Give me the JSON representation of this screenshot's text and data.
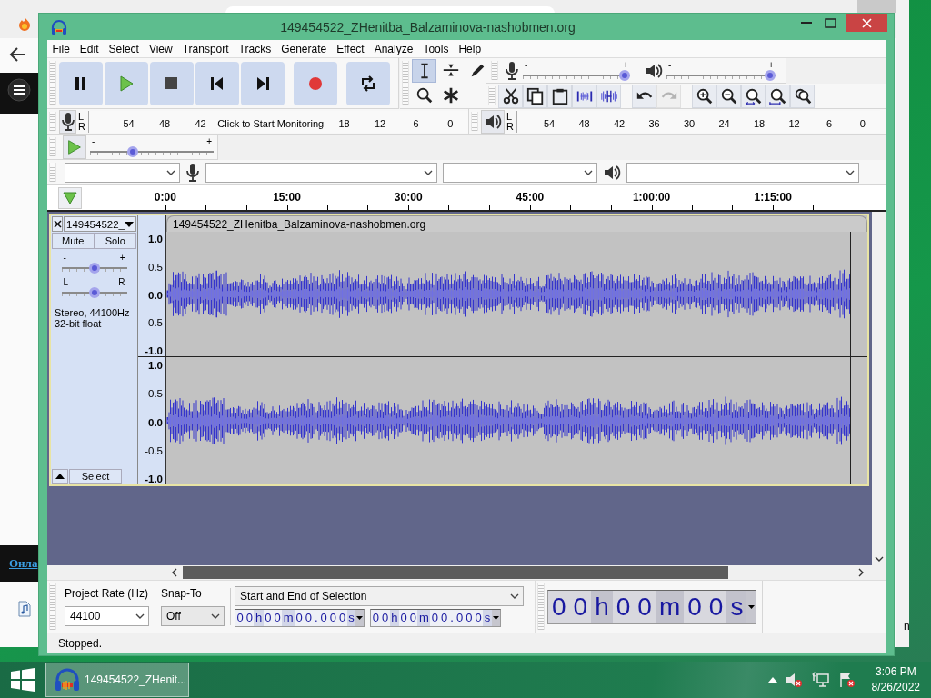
{
  "browser": {
    "link": "Онла",
    "edge_text": "n"
  },
  "window": {
    "title": "149454522_ZHenitba_Balzaminova-nashobmen.org"
  },
  "menu": [
    "File",
    "Edit",
    "Select",
    "View",
    "Transport",
    "Tracks",
    "Generate",
    "Effect",
    "Analyze",
    "Tools",
    "Help"
  ],
  "tools": [
    {
      "selected": true
    },
    {
      "selected": false
    },
    {
      "selected": false
    },
    {
      "selected": false
    },
    {
      "selected": false
    }
  ],
  "recording_volume": {
    "min_label": "-",
    "max_label": "+",
    "level": 1
  },
  "playback_volume": {
    "min_label": "-",
    "max_label": "+",
    "level": 1
  },
  "history": [
    {
      "disabled": false
    },
    {
      "disabled": true
    }
  ],
  "recording_meter": {
    "channels": [
      "L",
      "R"
    ],
    "scale": [
      {
        "kind": "tick",
        "label": "-54"
      },
      {
        "kind": "tick",
        "label": "-48"
      },
      {
        "kind": "tick",
        "label": "-42"
      },
      {
        "kind": "prompt",
        "label": "Click to Start Monitoring"
      },
      {
        "kind": "tick",
        "label": "-18"
      },
      {
        "kind": "tick",
        "label": "-12"
      },
      {
        "kind": "tick",
        "label": "-6"
      },
      {
        "kind": "tick",
        "label": "0"
      }
    ]
  },
  "playback_meter": {
    "channels": [
      "L",
      "R"
    ],
    "scale": [
      {
        "kind": "tick",
        "label": "-54"
      },
      {
        "kind": "tick",
        "label": "-48"
      },
      {
        "kind": "tick",
        "label": "-42"
      },
      {
        "kind": "tick",
        "label": "-36"
      },
      {
        "kind": "tick",
        "label": "-30"
      },
      {
        "kind": "tick",
        "label": "-24"
      },
      {
        "kind": "tick",
        "label": "-18"
      },
      {
        "kind": "tick",
        "label": "-12"
      },
      {
        "kind": "tick",
        "label": "-6"
      },
      {
        "kind": "tick",
        "label": "0"
      }
    ]
  },
  "play_at_speed": {
    "min_label": "-",
    "max_label": "+",
    "level": 0.33
  },
  "timeline": [
    "0:00",
    "15:00",
    "30:00",
    "45:00",
    "1:00:00",
    "1:15:00"
  ],
  "track": {
    "name": "149454522_",
    "clip_title": "149454522_ZHenitba_Balzaminova-nashobmen.org",
    "buttons": [
      "Mute",
      "Solo"
    ],
    "gain": {
      "min_label": "-",
      "max_label": "+",
      "level": 0.5
    },
    "pan": {
      "min_label": "L",
      "max_label": "R",
      "level": 0.5
    },
    "info": [
      "Stereo, 44100Hz",
      "32-bit float"
    ],
    "select_button": "Select",
    "channels": [
      {
        "scale": [
          "1.0",
          "0.5",
          "0.0",
          "-0.5",
          "-1.0"
        ]
      },
      {
        "scale": [
          "1.0",
          "0.5",
          "0.0",
          "-0.5",
          "-1.0"
        ]
      }
    ]
  },
  "selection_toolbar": {
    "rate_label": "Project Rate (Hz)",
    "rate": "44100",
    "snap_label": "Snap-To",
    "snap": "Off",
    "selection_mode": "Start and End of Selection",
    "start": "00h00m00.000s",
    "end": "00h00m00.000s"
  },
  "time_display": "00h00m00s",
  "status": "Stopped.",
  "taskbar": {
    "task": "149454522_ZHenit...",
    "time": "3:06 PM",
    "date": "8/26/2022"
  }
}
